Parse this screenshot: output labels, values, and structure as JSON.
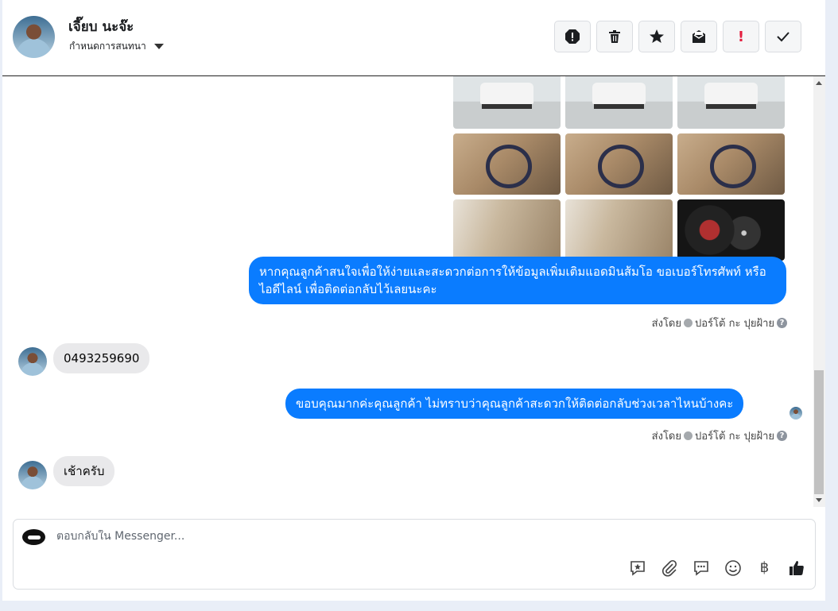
{
  "header": {
    "name": "เจี๊ยบ นะจ๊ะ",
    "assign_label": "กำหนดการสนทนา",
    "toolbar": [
      {
        "name": "spam-icon",
        "glyph": "⬤"
      },
      {
        "name": "trash-icon",
        "glyph": "🗑"
      },
      {
        "name": "star-icon",
        "glyph": "★"
      },
      {
        "name": "mark-unread-icon",
        "glyph": "✉"
      },
      {
        "name": "follow-up-icon",
        "glyph": "!"
      },
      {
        "name": "done-icon",
        "glyph": "✓"
      }
    ]
  },
  "messages": {
    "m1": "หากคุณลูกค้าสนใจเพื่อให้ง่ายและสะดวกต่อการให้ข้อมูลเพิ่มเติมแอดมินส้มโอ ขอเบอร์โทรศัพท์ หรือ ไอดีไลน์ เพื่อติดต่อกลับไว้เลยนะคะ",
    "m1_sent_by": "ส่งโดย",
    "m1_sender": "ปอร์โต้ กะ ปุยฝ้าย",
    "m2": "0493259690",
    "m3": "ขอบคุณมากค่ะคุณลูกค้า ไม่ทราบว่าคุณลูกค้าสะดวกให้ติดต่อกลับช่วงเวลาไหนบ้างคะ",
    "m3_sent_by": "ส่งโดย",
    "m3_sender": "ปอร์โต้ กะ ปุยฝ้าย",
    "m4": "เช้าครับ"
  },
  "composer": {
    "placeholder": "ตอบกลับใน Messenger...",
    "currency_glyph": "฿"
  }
}
